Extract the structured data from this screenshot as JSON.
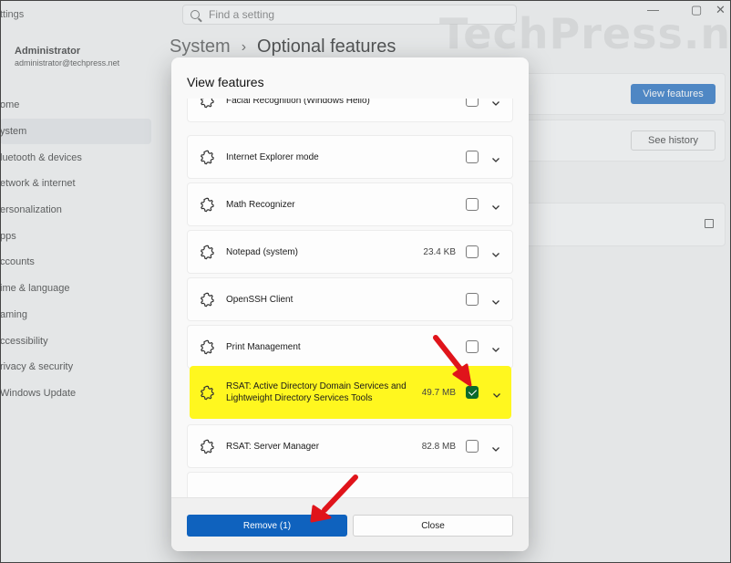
{
  "window": {
    "title_fragment": "ttings",
    "search_placeholder": "Find a setting",
    "controls": [
      "—",
      "▢",
      "✕"
    ],
    "watermark": "TechPress.net"
  },
  "user": {
    "name": "Administrator",
    "email": "administrator@techpress.net"
  },
  "sidebar": {
    "items": [
      {
        "label": "ome",
        "active": false
      },
      {
        "label": "ystem",
        "active": true
      },
      {
        "label": "luetooth & devices",
        "active": false
      },
      {
        "label": "etwork & internet",
        "active": false
      },
      {
        "label": "ersonalization",
        "active": false
      },
      {
        "label": "pps",
        "active": false
      },
      {
        "label": "ccounts",
        "active": false
      },
      {
        "label": "ime & language",
        "active": false
      },
      {
        "label": "aming",
        "active": false
      },
      {
        "label": "ccessibility",
        "active": false
      },
      {
        "label": "rivacy & security",
        "active": false
      },
      {
        "label": "Windows Update",
        "active": false
      }
    ]
  },
  "breadcrumb": {
    "root": "System",
    "separator": "›",
    "page": "Optional features"
  },
  "main": {
    "view_features_label": "View features",
    "see_history_label": "See history"
  },
  "dialog": {
    "title": "View features",
    "features": [
      {
        "name": "Facial Recognition (Windows Hello)",
        "size": "",
        "checked": false,
        "highlight": false
      },
      {
        "name": "Internet Explorer mode",
        "size": "",
        "checked": false,
        "highlight": false
      },
      {
        "name": "Math Recognizer",
        "size": "",
        "checked": false,
        "highlight": false
      },
      {
        "name": "Notepad (system)",
        "size": "23.4 KB",
        "checked": false,
        "highlight": false
      },
      {
        "name": "OpenSSH Client",
        "size": "",
        "checked": false,
        "highlight": false
      },
      {
        "name": "Print Management",
        "size": "",
        "checked": false,
        "highlight": false
      },
      {
        "name": "RSAT: Active Directory Domain Services and Lightweight Directory Services Tools",
        "size": "49.7 MB",
        "checked": true,
        "highlight": true
      },
      {
        "name": "RSAT: Server Manager",
        "size": "82.8 MB",
        "checked": false,
        "highlight": false
      }
    ],
    "remove_label": "Remove (1)",
    "close_label": "Close"
  },
  "colors": {
    "accent": "#0f62be",
    "highlight": "#fff71f",
    "checkbox_checked": "#0c6a2c",
    "annotation_arrow": "#e0141b"
  }
}
